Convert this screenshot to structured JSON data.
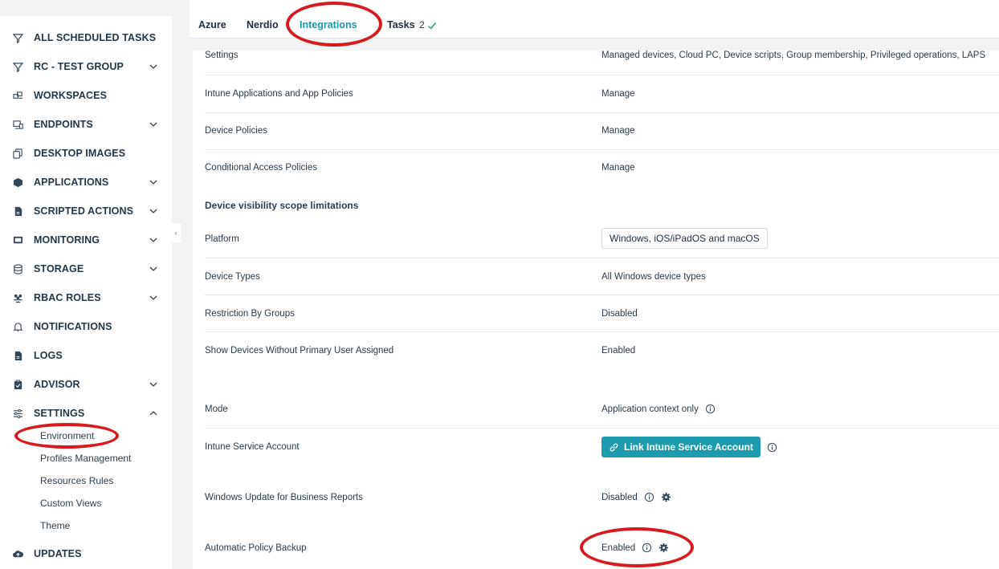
{
  "sidebar": {
    "items": [
      {
        "label": "ALL SCHEDULED TASKS",
        "icon": "filter-icon",
        "chevron": false
      },
      {
        "label": "RC - TEST GROUP",
        "icon": "filter-icon",
        "chevron": "down"
      },
      {
        "label": "WORKSPACES",
        "icon": "workspaces-icon",
        "chevron": false
      },
      {
        "label": "ENDPOINTS",
        "icon": "endpoints-icon",
        "chevron": "down"
      },
      {
        "label": "DESKTOP IMAGES",
        "icon": "copy-icon",
        "chevron": false
      },
      {
        "label": "APPLICATIONS",
        "icon": "cube-icon",
        "chevron": "down"
      },
      {
        "label": "SCRIPTED ACTIONS",
        "icon": "file-icon",
        "chevron": "down"
      },
      {
        "label": "MONITORING",
        "icon": "monitor-icon",
        "chevron": "down"
      },
      {
        "label": "STORAGE",
        "icon": "database-icon",
        "chevron": "down"
      },
      {
        "label": "RBAC ROLES",
        "icon": "users-icon",
        "chevron": "down"
      },
      {
        "label": "NOTIFICATIONS",
        "icon": "bell-icon",
        "chevron": false
      },
      {
        "label": "LOGS",
        "icon": "file-icon",
        "chevron": false
      },
      {
        "label": "ADVISOR",
        "icon": "clipboard-icon",
        "chevron": "down"
      },
      {
        "label": "SETTINGS",
        "icon": "sliders-icon",
        "chevron": "up"
      }
    ],
    "settings_sub": [
      "Environment",
      "Profiles Management",
      "Resources Rules",
      "Custom Views",
      "Theme"
    ],
    "updates_label": "UPDATES"
  },
  "tabs": [
    {
      "label": "Azure"
    },
    {
      "label": "Nerdio"
    },
    {
      "label": "Integrations"
    },
    {
      "label": "Tasks"
    }
  ],
  "tasks_count": "2",
  "rows": {
    "settings": {
      "label": "Settings",
      "value": "Managed devices, Cloud PC, Device scripts, Group membership, Privileged operations, LAPS"
    },
    "intune_apps": {
      "label": "Intune Applications and App Policies",
      "value": "Manage"
    },
    "device_policies": {
      "label": "Device Policies",
      "value": "Manage"
    },
    "conditional_access": {
      "label": "Conditional Access Policies",
      "value": "Manage"
    },
    "scope_title": "Device visibility scope limitations",
    "platform": {
      "label": "Platform",
      "value": "Windows, iOS/iPadOS and macOS"
    },
    "device_types": {
      "label": "Device Types",
      "value": "All Windows device types"
    },
    "restriction": {
      "label": "Restriction By Groups",
      "value": "Disabled"
    },
    "show_devices": {
      "label": "Show Devices Without Primary User Assigned",
      "value": "Enabled"
    },
    "mode": {
      "label": "Mode",
      "value": "Application context only"
    },
    "service_account": {
      "label": "Intune Service Account",
      "button": "Link Intune Service Account"
    },
    "wufb": {
      "label": "Windows Update for Business Reports",
      "value": "Disabled"
    },
    "backup": {
      "label": "Automatic Policy Backup",
      "value": "Enabled"
    }
  },
  "colors": {
    "accent": "#1e9bb0",
    "annotation": "#d71920"
  }
}
